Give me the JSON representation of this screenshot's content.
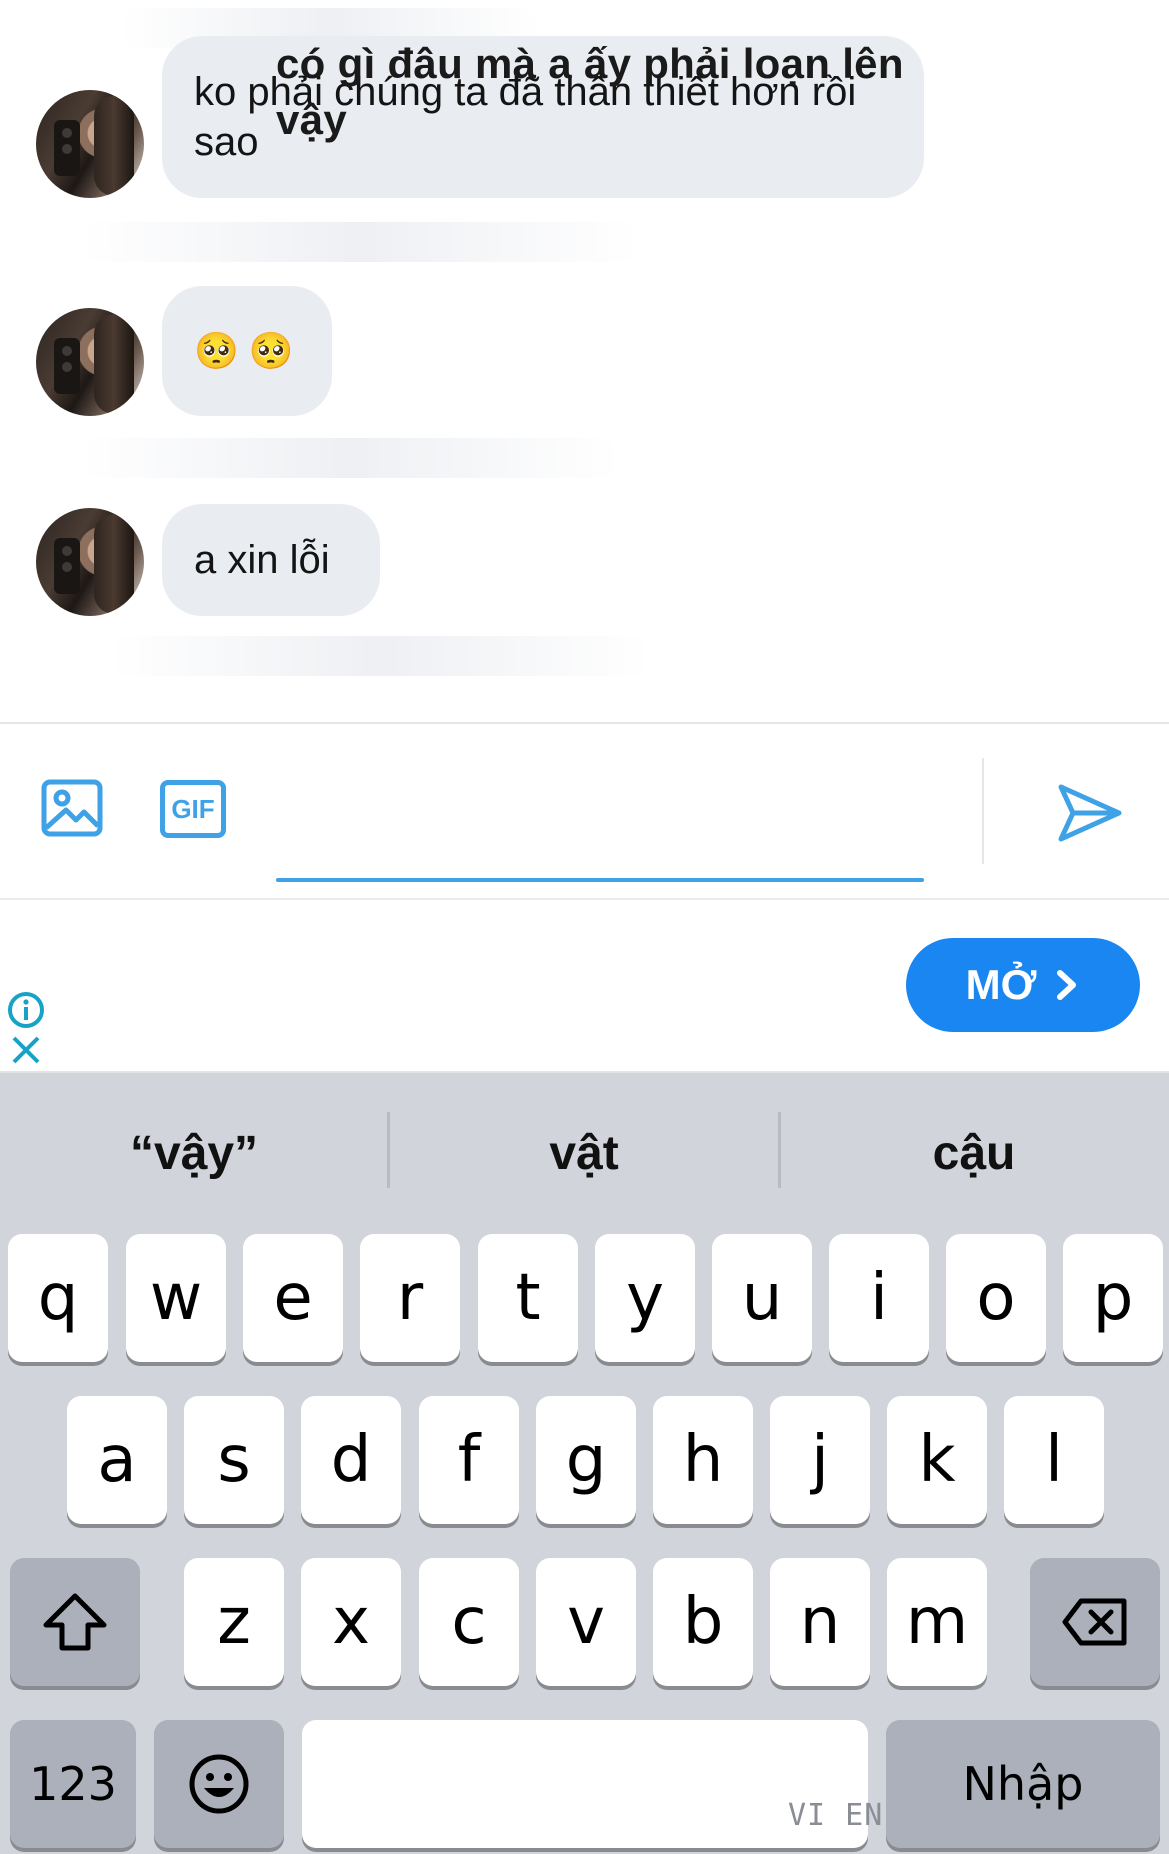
{
  "messages": [
    {
      "text": "ko phải chúng ta đã thân thiết hơn rồi sao"
    },
    {
      "text": "🥺 🥺"
    },
    {
      "text": "a xin lỗi"
    }
  ],
  "composer": {
    "image_icon": "image-icon",
    "gif_label": "GIF",
    "input_value": "có gì đâu mà a ấy phải loạn lên vậy",
    "send_icon": "send-icon"
  },
  "ad": {
    "info_icon": "info-icon",
    "close_icon": "close-icon",
    "open_label": "MỞ",
    "open_icon": "chevron-right-icon"
  },
  "keyboard": {
    "suggestions": [
      "“vậy”",
      "vật",
      "cậu"
    ],
    "row1": [
      "q",
      "w",
      "e",
      "r",
      "t",
      "y",
      "u",
      "i",
      "o",
      "p"
    ],
    "row2": [
      "a",
      "s",
      "d",
      "f",
      "g",
      "h",
      "j",
      "k",
      "l"
    ],
    "row3": [
      "z",
      "x",
      "c",
      "v",
      "b",
      "n",
      "m"
    ],
    "numbers_label": "123",
    "return_label": "Nhập",
    "language_label": "VI EN",
    "shift_icon": "shift-icon",
    "backspace_icon": "backspace-icon",
    "emoji_icon": "emoji-icon"
  },
  "colors": {
    "accent": "#1a86f2",
    "bubble": "#e9edf2",
    "keyboard_bg": "#d1d4da"
  }
}
